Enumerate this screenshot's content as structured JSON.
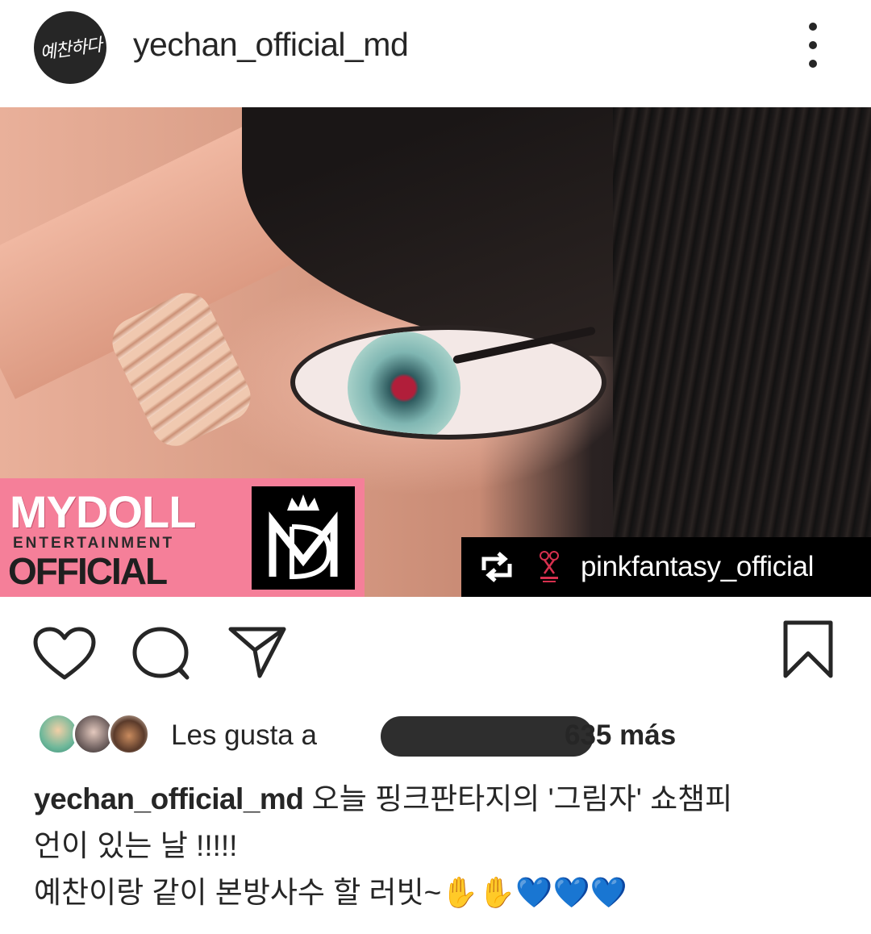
{
  "header": {
    "username": "yechan_official_md",
    "avatar_text": "예찬하다",
    "more_icon": "more-vertical-icon"
  },
  "post": {
    "brand_title": "MYDOLL",
    "brand_sub": "ENTERTAINMENT",
    "brand_official": "OFFICIAL",
    "repost_user": "pinkfantasy_official",
    "repost_icon": "repost-icon",
    "colors": {
      "brand_pink": "#f57f99",
      "overlay_black": "#000000"
    }
  },
  "actions": {
    "like_icon": "heart-icon",
    "comment_icon": "comment-icon",
    "share_icon": "send-icon",
    "save_icon": "bookmark-icon"
  },
  "likes": {
    "prefix": "Les gusta a",
    "count": "635 más"
  },
  "caption": {
    "username": "yechan_official_md",
    "line1": " 오늘 핑크판타지의 '그림자' 쇼챔피",
    "line2": "언이 있는 날 !!!!!",
    "line3": "예찬이랑 같이 본방사수 할 러빗~",
    "emojis": "✋✋💙💙💙"
  }
}
